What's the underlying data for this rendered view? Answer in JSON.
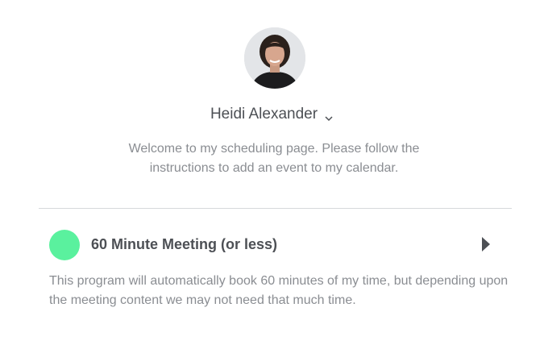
{
  "profile": {
    "name": "Heidi Alexander",
    "avatar_icon": "profile-photo",
    "dropdown_icon": "chevron-down-icon"
  },
  "welcome_text": "Welcome to my scheduling page. Please follow the instructions to add an event to my calendar.",
  "event": {
    "title": "60 Minute Meeting (or less)",
    "color": "#5af19e",
    "description": "This program will automatically book 60 minutes of my time, but depending upon the meeting content we may not need that much time.",
    "arrow_icon": "triangle-right-icon"
  }
}
